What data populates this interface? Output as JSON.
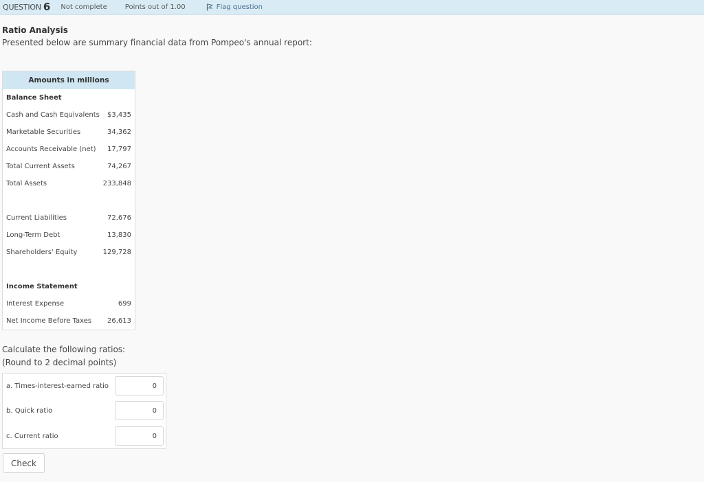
{
  "question_bar": {
    "question_label": "QUESTION",
    "question_number": "6",
    "status": "Not complete",
    "points": "Points out of 1.00",
    "flag_label": "Flag question"
  },
  "content": {
    "title": "Ratio Analysis",
    "intro": "Presented below are summary financial data from Pompeo's annual report:"
  },
  "table": {
    "header": "Amounts in millions",
    "sections": {
      "balance_sheet": "Balance Sheet",
      "income_statement": "Income Statement"
    },
    "rows": [
      {
        "label": "Cash and Cash Equivalents",
        "value": "$3,435"
      },
      {
        "label": "Marketable Securities",
        "value": "34,362"
      },
      {
        "label": "Accounts Receivable (net)",
        "value": "17,797"
      },
      {
        "label": "Total Current Assets",
        "value": "74,267"
      },
      {
        "label": "Total Assets",
        "value": "233,848"
      },
      {
        "label": "Current Liabilities",
        "value": "72,676"
      },
      {
        "label": "Long-Term Debt",
        "value": "13,830"
      },
      {
        "label": "Shareholders' Equity",
        "value": "129,728"
      },
      {
        "label": "Interest Expense",
        "value": "699"
      },
      {
        "label": "Net Income Before Taxes",
        "value": "26,613"
      }
    ]
  },
  "calculate": {
    "line1": "Calculate the following ratios:",
    "line2": "(Round to 2 decimal points)"
  },
  "answers": [
    {
      "label": "a. Times-interest-earned ratio",
      "value": "0"
    },
    {
      "label": "b. Quick ratio",
      "value": "0"
    },
    {
      "label": "c. Current ratio",
      "value": "0"
    }
  ],
  "check_button": "Check"
}
